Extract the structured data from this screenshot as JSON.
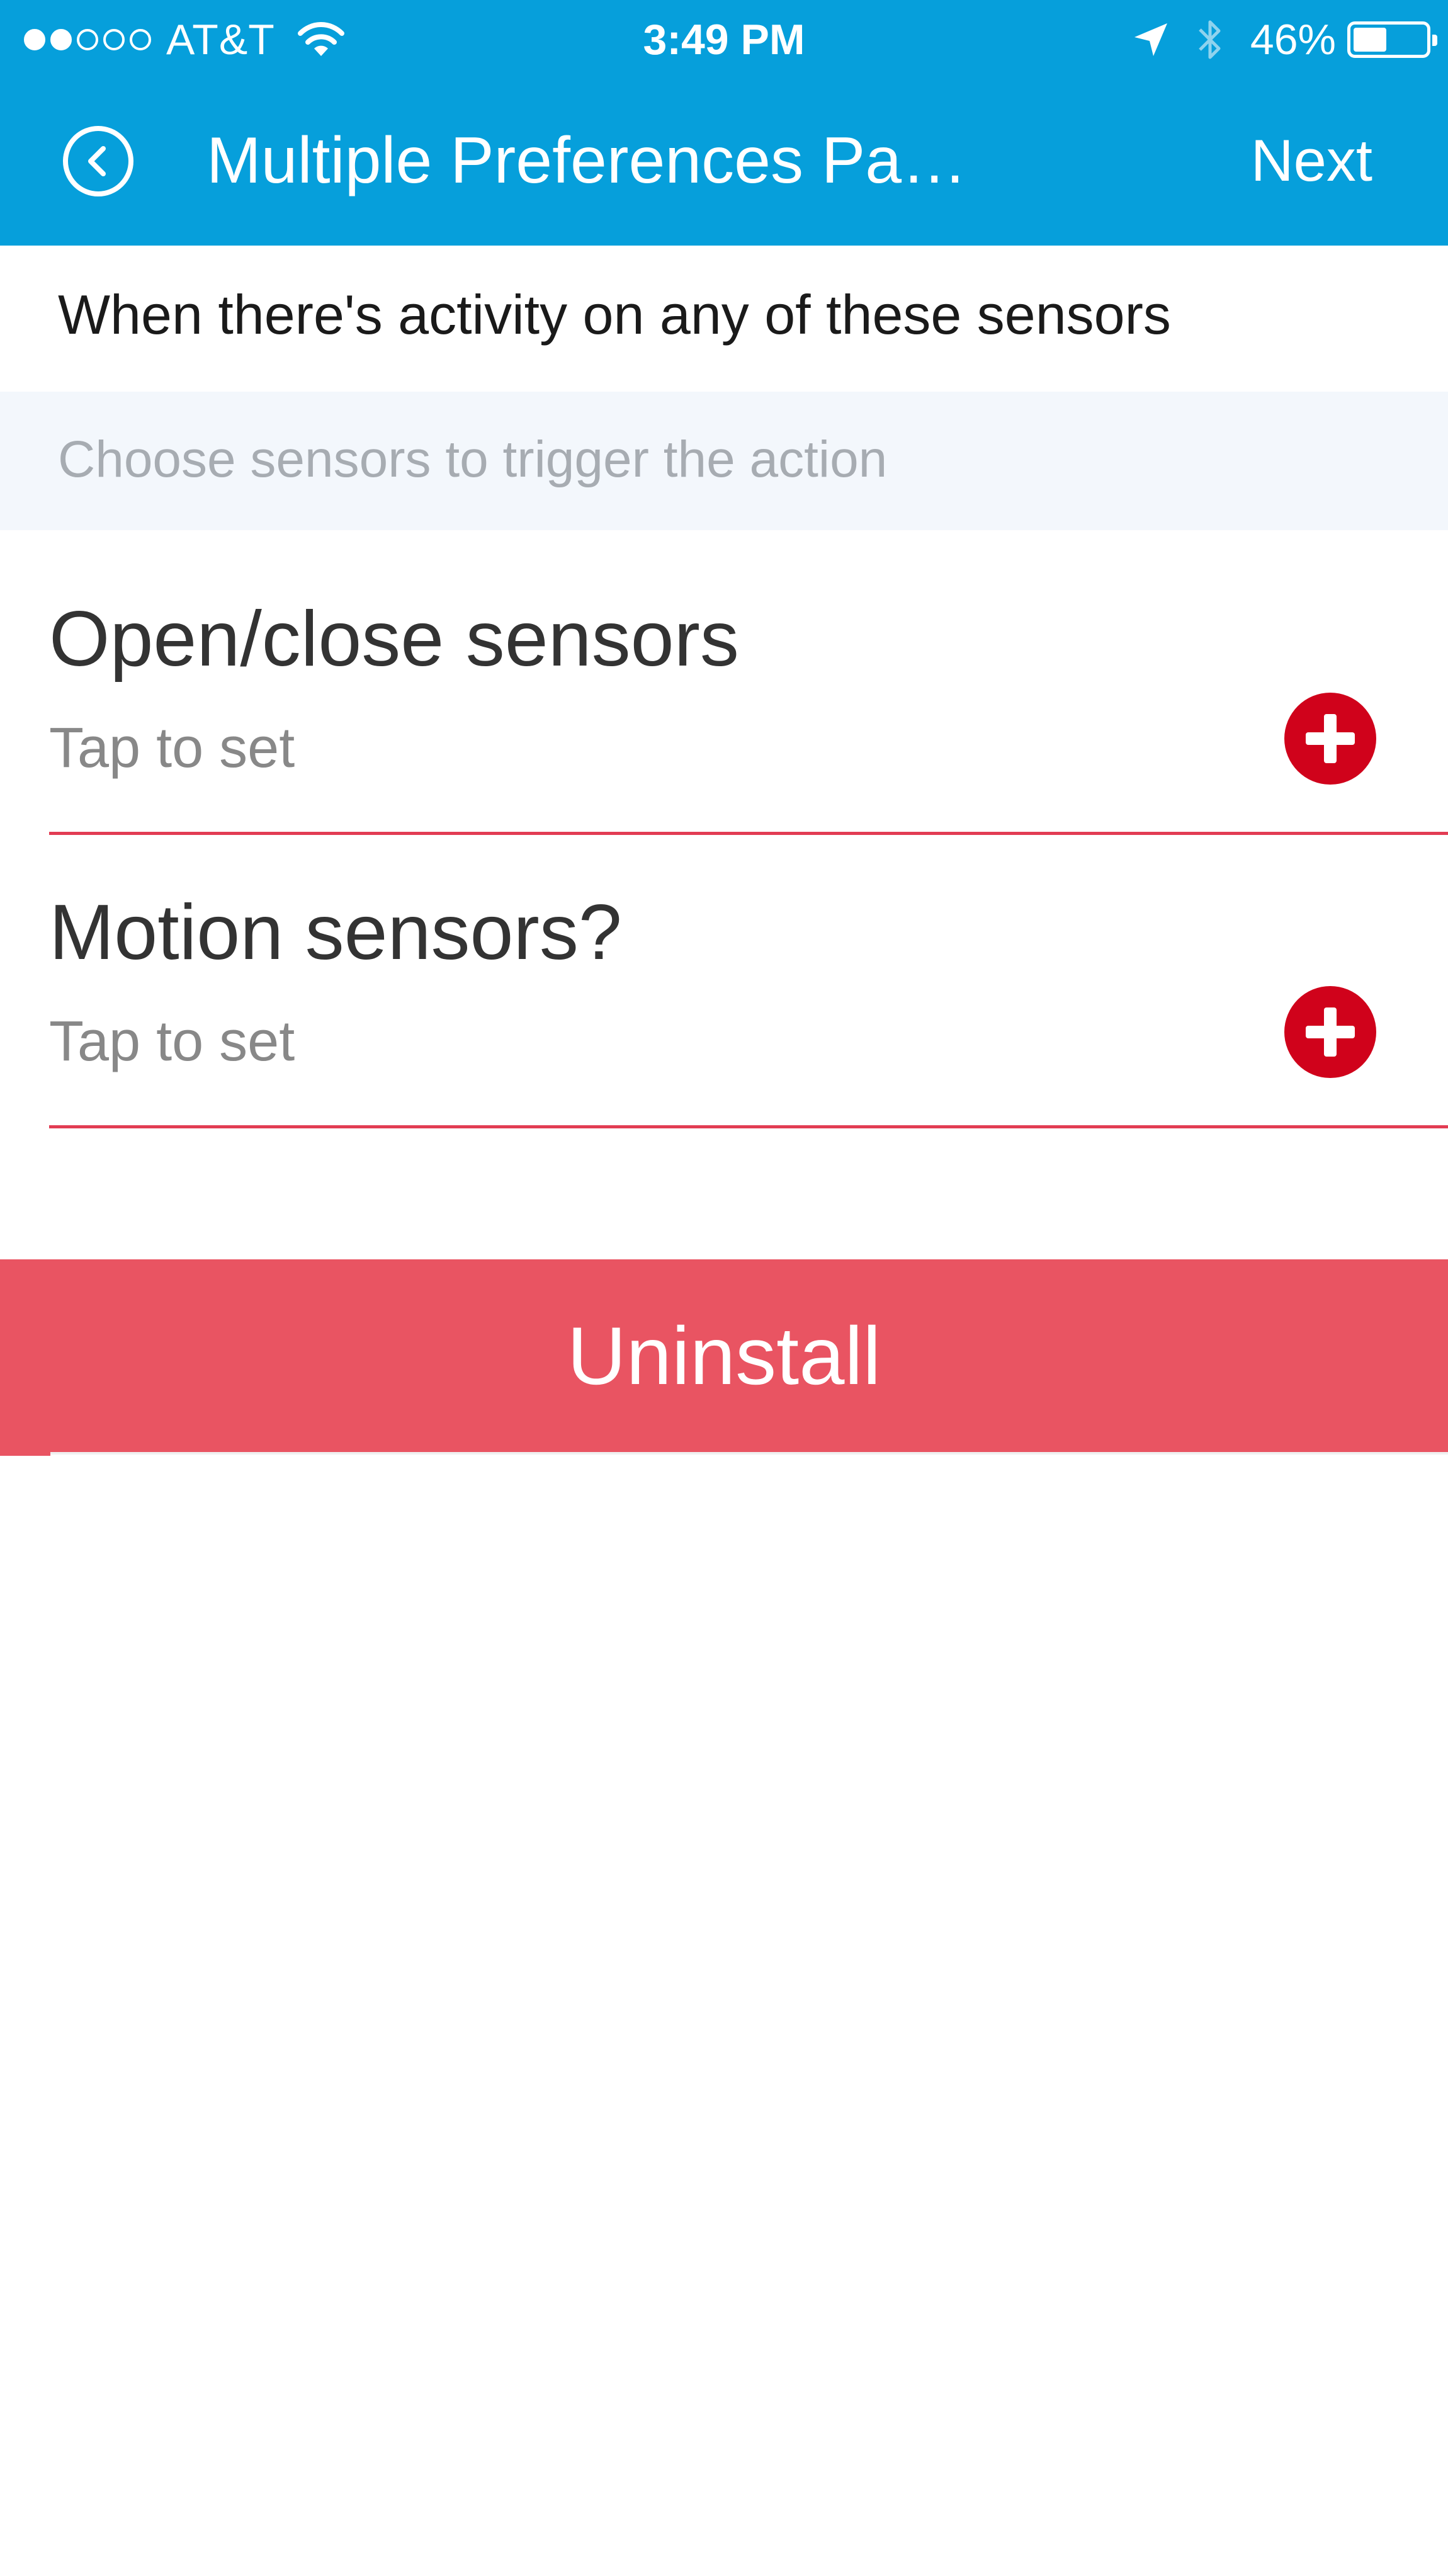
{
  "status_bar": {
    "carrier": "AT&T",
    "time": "3:49 PM",
    "battery_percent": "46%",
    "battery_level": 0.46,
    "signal_bars_filled": 2,
    "signal_bars_total": 5
  },
  "nav": {
    "back_icon": "chevron-left-circle-icon",
    "title": "Multiple Preferences Pa…",
    "next_label": "Next"
  },
  "section": {
    "header": "When there's activity on any of these sensors",
    "hint": "Choose sensors to trigger the action"
  },
  "preferences": [
    {
      "title": "Open/close sensors",
      "subtitle": "Tap to set",
      "icon": "add-icon"
    },
    {
      "title": "Motion sensors?",
      "subtitle": "Tap to set",
      "icon": "add-icon"
    }
  ],
  "actions": {
    "uninstall_label": "Uninstall"
  },
  "colors": {
    "header_blue": "#069fdb",
    "accent_red": "#d0021b",
    "uninstall_red": "#e95462",
    "divider_red": "#e23c53"
  }
}
